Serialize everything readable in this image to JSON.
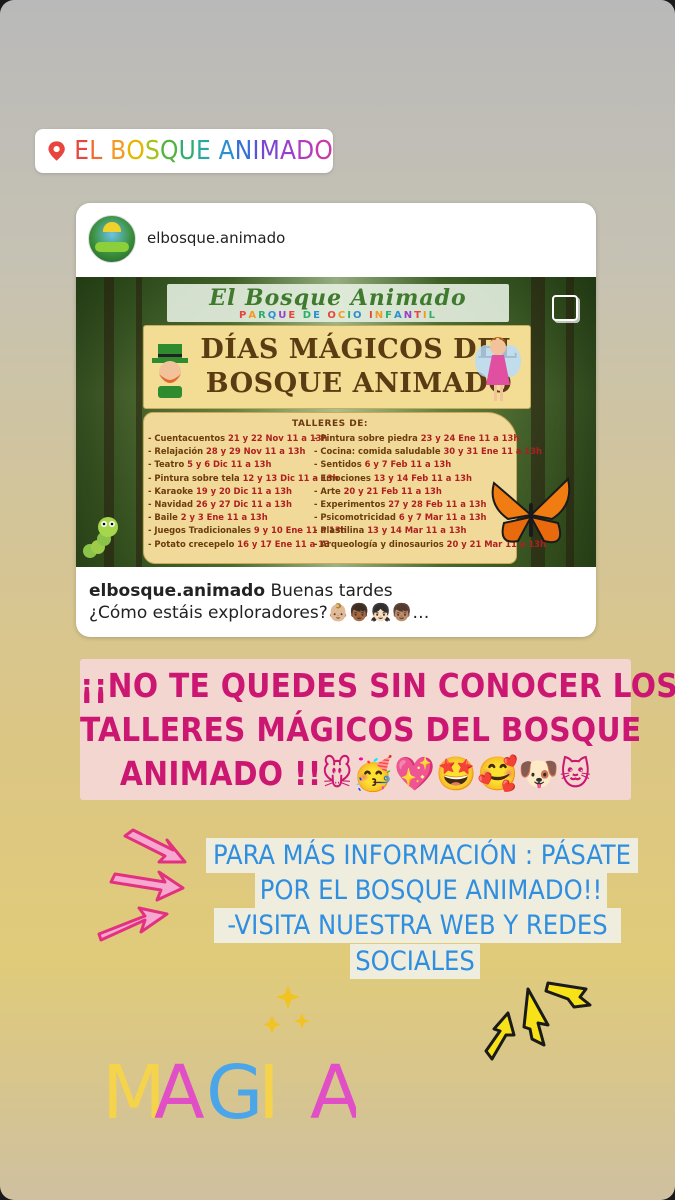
{
  "location_sticker": {
    "icon": "location-pin-icon",
    "text_letters": [
      "E",
      "L",
      " ",
      "B",
      "O",
      "S",
      "Q",
      "U",
      "E",
      " ",
      "A",
      "N",
      "I",
      "M",
      "A",
      "D",
      "O"
    ],
    "letter_colors": [
      "#e8453c",
      "#ef6b2e",
      "#ffffff",
      "#f29a23",
      "#e6b500",
      "#a7c21a",
      "#52b33d",
      "#2dae6e",
      "#28a9a0",
      " ",
      "#2e8fd0",
      "#3a6fd6",
      "#5a55d8",
      "#7b45d4",
      "#9a3fcc",
      "#b43bbd",
      "#c83aa8"
    ]
  },
  "post": {
    "username": "elbosque.animado",
    "image": {
      "title_script": "El Bosque Animado",
      "subtitle_letters": [
        "P",
        "A",
        "R",
        "Q",
        "U",
        "E",
        " ",
        "D",
        "E",
        " ",
        "O",
        "C",
        "I",
        "O",
        " ",
        "I",
        "N",
        "F",
        "A",
        "N",
        "T",
        "I",
        "L"
      ],
      "heading_line1": "DÍAS MÁGICOS DEL",
      "heading_line2": "BOSQUE ANIMADO",
      "talleres_title": "TALLERES DE:",
      "left_column": [
        {
          "name": "Cuentacuentos",
          "dates": "21 y 22 Nov 11 a 13h"
        },
        {
          "name": "Relajación",
          "dates": "28 y 29 Nov 11 a 13h"
        },
        {
          "name": "Teatro",
          "dates": "5 y 6 Dic 11 a 13h"
        },
        {
          "name": "Pintura sobre tela",
          "dates": "12 y 13 Dic 11 a 13h"
        },
        {
          "name": "Karaoke",
          "dates": "19 y 20 Dic 11 a 13h"
        },
        {
          "name": "Navidad",
          "dates": "26 y 27 Dic 11 a 13h"
        },
        {
          "name": "Baile",
          "dates": "2 y 3 Ene 11 a 13h"
        },
        {
          "name": "Juegos Tradicionales",
          "dates": "9 y 10 Ene 11 a 13h"
        },
        {
          "name": "Potato crecepelo",
          "dates": "16 y 17 Ene 11 a 13"
        }
      ],
      "right_column": [
        {
          "name": "Pintura sobre piedra",
          "dates": "23 y 24 Ene 11 a 13h"
        },
        {
          "name": "Cocina: comida saludable",
          "dates": "30 y 31 Ene 11 a 13h"
        },
        {
          "name": "Sentidos",
          "dates": "6 y 7 Feb 11 a 13h"
        },
        {
          "name": "Emociones",
          "dates": "13 y 14 Feb 11 a 13h"
        },
        {
          "name": "Arte",
          "dates": "20 y 21 Feb 11 a 13h"
        },
        {
          "name": "Experimentos",
          "dates": "27 y 28 Feb 11 a 13h"
        },
        {
          "name": "Psicomotricidad",
          "dates": "6 y 7 Mar 11 a 13h"
        },
        {
          "name": "Plastilina",
          "dates": "13 y 14 Mar 11 a 13h"
        },
        {
          "name": "Arqueología y dinosaurios",
          "dates": "20 y 21 Mar 11 a 13h"
        }
      ]
    },
    "caption_user": "elbosque.animado",
    "caption_line1": "Buenas tardes",
    "caption_line2": "¿Cómo estáis exploradores?👶🏼👦🏾👧🏻👦🏽…"
  },
  "pink_sticker": {
    "line1": "¡¡NO TE QUEDES SIN CONOCER LOS",
    "line2": "TALLERES MÁGICOS DEL BOSQUE",
    "line3": "ANIMADO !!🐭🥳💖🤩🥰🐶🐱",
    "color": "#cc1772"
  },
  "info_sticker": {
    "line1": "PARA MÁS INFORMACIÓN : PÁSATE",
    "line2": "POR EL BOSQUE ANIMADO!!",
    "line3": "-VISITA NUESTRA WEB Y REDES",
    "line4": "SOCIALES",
    "color": "#2f8ee0"
  },
  "decorations": {
    "left_arrows": "pink-arrows-icon",
    "right_arrows": "yellow-arrows-icon",
    "sparkles": "sparkles-icon"
  },
  "magia": {
    "letters": [
      "M",
      "A",
      "G",
      "I",
      "A"
    ],
    "colors": [
      "#f5d34a",
      "#e14fc6",
      "#4aa6e8",
      "#f5d34a",
      "#e14fc6"
    ]
  }
}
